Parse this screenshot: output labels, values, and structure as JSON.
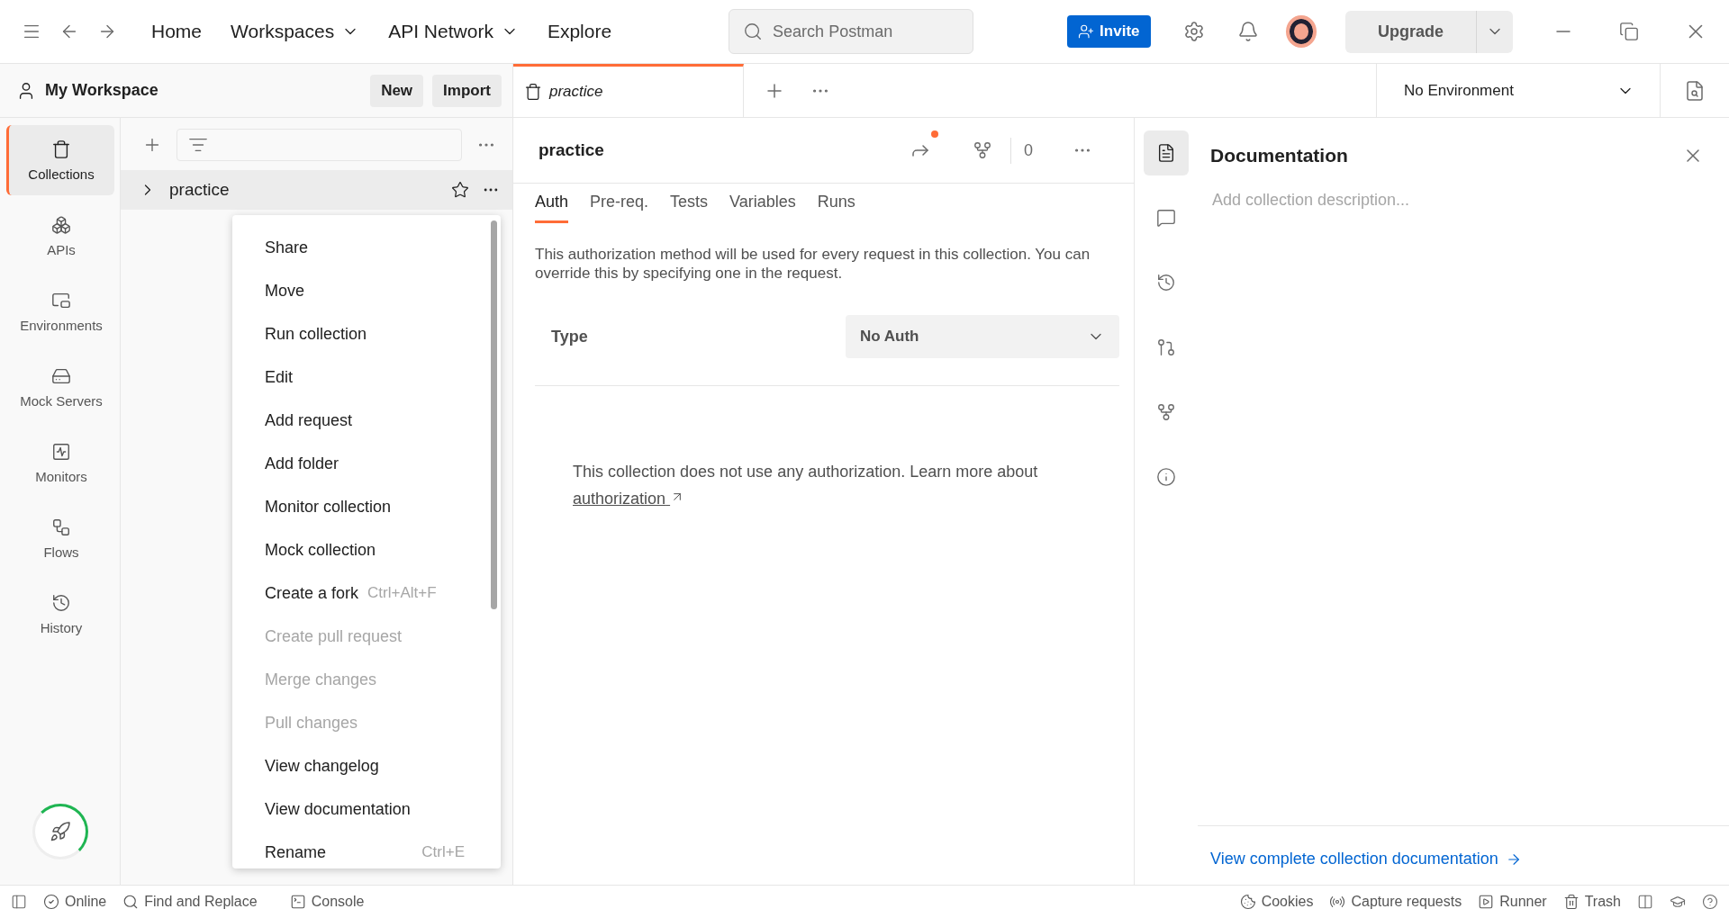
{
  "topbar": {
    "nav": [
      {
        "label": "Home",
        "dropdown": false
      },
      {
        "label": "Workspaces",
        "dropdown": true
      },
      {
        "label": "API Network",
        "dropdown": true
      },
      {
        "label": "Explore",
        "dropdown": false
      }
    ],
    "search": {
      "placeholder": "Search Postman"
    },
    "invite": "Invite",
    "upgrade": "Upgrade"
  },
  "workspace": {
    "title": "My Workspace",
    "buttons": [
      "New",
      "Import"
    ]
  },
  "tabs": [
    {
      "label": "practice",
      "selected": true
    }
  ],
  "environment": {
    "value": "No Environment"
  },
  "nav": [
    {
      "kind": "collections",
      "label": "Collections",
      "selected": true
    },
    {
      "kind": "apis",
      "label": "APIs",
      "selected": false
    },
    {
      "kind": "environments",
      "label": "Environments",
      "selected": false
    },
    {
      "kind": "mock",
      "label": "Mock Servers",
      "selected": false
    },
    {
      "kind": "monitors",
      "label": "Monitors",
      "selected": false
    },
    {
      "kind": "flows",
      "label": "Flows",
      "selected": false
    },
    {
      "kind": "history",
      "label": "History",
      "selected": false
    }
  ],
  "collections": [
    {
      "name": "practice",
      "expanded": false
    }
  ],
  "context_menu": {
    "items": [
      {
        "label": "Share",
        "disabled": false
      },
      {
        "label": "Move",
        "disabled": false
      },
      {
        "label": "Run collection",
        "disabled": false
      },
      {
        "label": "Edit",
        "disabled": false
      },
      {
        "label": "Add request",
        "disabled": false
      },
      {
        "label": "Add folder",
        "disabled": false
      },
      {
        "label": "Monitor collection",
        "disabled": false
      },
      {
        "label": "Mock collection",
        "disabled": false
      },
      {
        "label": "Create a fork",
        "shortcut": "Ctrl+Alt+F",
        "disabled": false
      },
      {
        "label": "Create pull request",
        "disabled": true
      },
      {
        "label": "Merge changes",
        "disabled": true
      },
      {
        "label": "Pull changes",
        "disabled": true
      },
      {
        "label": "View changelog",
        "disabled": false
      },
      {
        "label": "View documentation",
        "disabled": false
      },
      {
        "label": "Rename",
        "shortcut": "Ctrl+E",
        "disabled": false
      }
    ]
  },
  "collection_view": {
    "title": "practice",
    "share_notification": true,
    "fork_count": "0",
    "tabs": [
      {
        "label": "Auth",
        "selected": true
      },
      {
        "label": "Pre-req.",
        "selected": false
      },
      {
        "label": "Tests",
        "selected": false
      },
      {
        "label": "Variables",
        "selected": false
      },
      {
        "label": "Runs",
        "selected": false
      }
    ],
    "description": "This authorization method will be used for every request in this collection. You can override this by specifying one in the request.",
    "type_label": "Type",
    "type_value": "No Auth",
    "note": "This collection does not use any authorization. Learn more about",
    "link": "authorization"
  },
  "documentation": {
    "title": "Documentation",
    "placeholder": "Add collection description...",
    "link": "View complete collection documentation",
    "rail": [
      {
        "kind": "docs",
        "selected": true
      },
      {
        "kind": "comments",
        "selected": false
      },
      {
        "kind": "history",
        "selected": false
      },
      {
        "kind": "pull",
        "selected": false
      },
      {
        "kind": "fork",
        "selected": false
      },
      {
        "kind": "info",
        "selected": false
      }
    ]
  },
  "status_bar": {
    "left": [
      {
        "kind": "online",
        "label": "Online"
      },
      {
        "kind": "find",
        "label": "Find and Replace"
      },
      {
        "kind": "console",
        "label": "Console"
      }
    ],
    "right": [
      {
        "kind": "cookies",
        "label": "Cookies"
      },
      {
        "kind": "capture",
        "label": "Capture requests"
      },
      {
        "kind": "runner",
        "label": "Runner"
      },
      {
        "kind": "trash",
        "label": "Trash"
      }
    ]
  }
}
